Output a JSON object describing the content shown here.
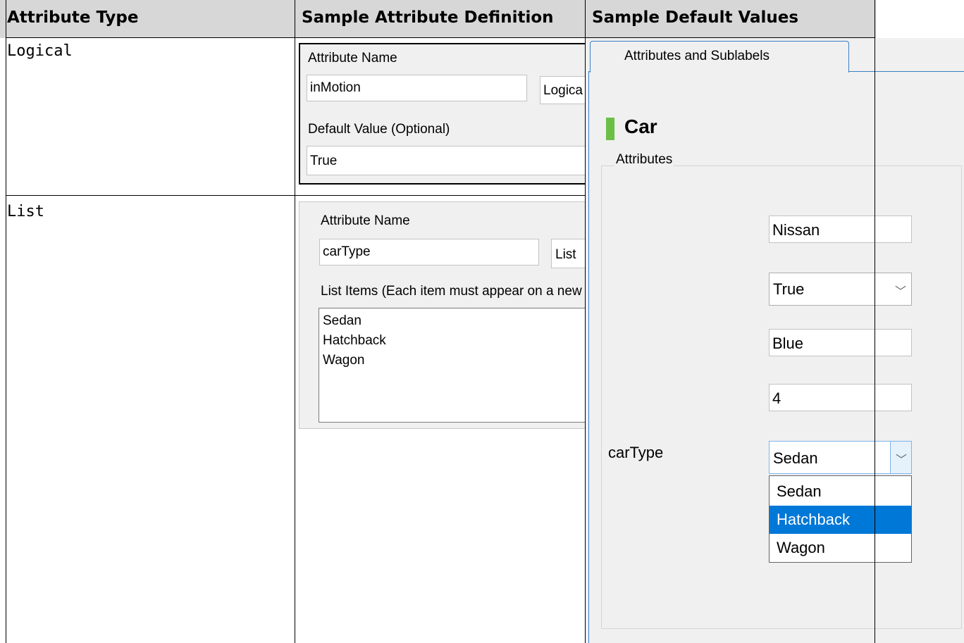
{
  "table": {
    "headers": [
      "Attribute Type",
      "Sample Attribute Definition",
      "Sample Default Values"
    ],
    "rows": [
      {
        "type": "Logical"
      },
      {
        "type": "List"
      }
    ]
  },
  "logical_definition": {
    "name_label": "Attribute Name",
    "name_value": "inMotion",
    "type_value": "Logica",
    "default_label": "Default Value (Optional)",
    "default_value": "True"
  },
  "list_definition": {
    "name_label": "Attribute Name",
    "name_value": "carType",
    "type_value": "List",
    "items_label": "List Items (Each item must appear on a new line)",
    "items": [
      "Sedan",
      "Hatchback",
      "Wagon"
    ]
  },
  "defaults_panel": {
    "tab_label": "Attributes and Sublabels",
    "label_name": "Car",
    "label_color": "#6bbf47",
    "group_title": "Attributes",
    "fields": {
      "text1": "Nissan",
      "logical": "True",
      "text2": "Blue",
      "numeric": "4",
      "cartype_label": "carType",
      "cartype_value": "Sedan"
    },
    "dropdown_options": [
      "Sedan",
      "Hatchback",
      "Wagon"
    ],
    "dropdown_selected": "Hatchback",
    "selection_color": "#0078d7"
  }
}
